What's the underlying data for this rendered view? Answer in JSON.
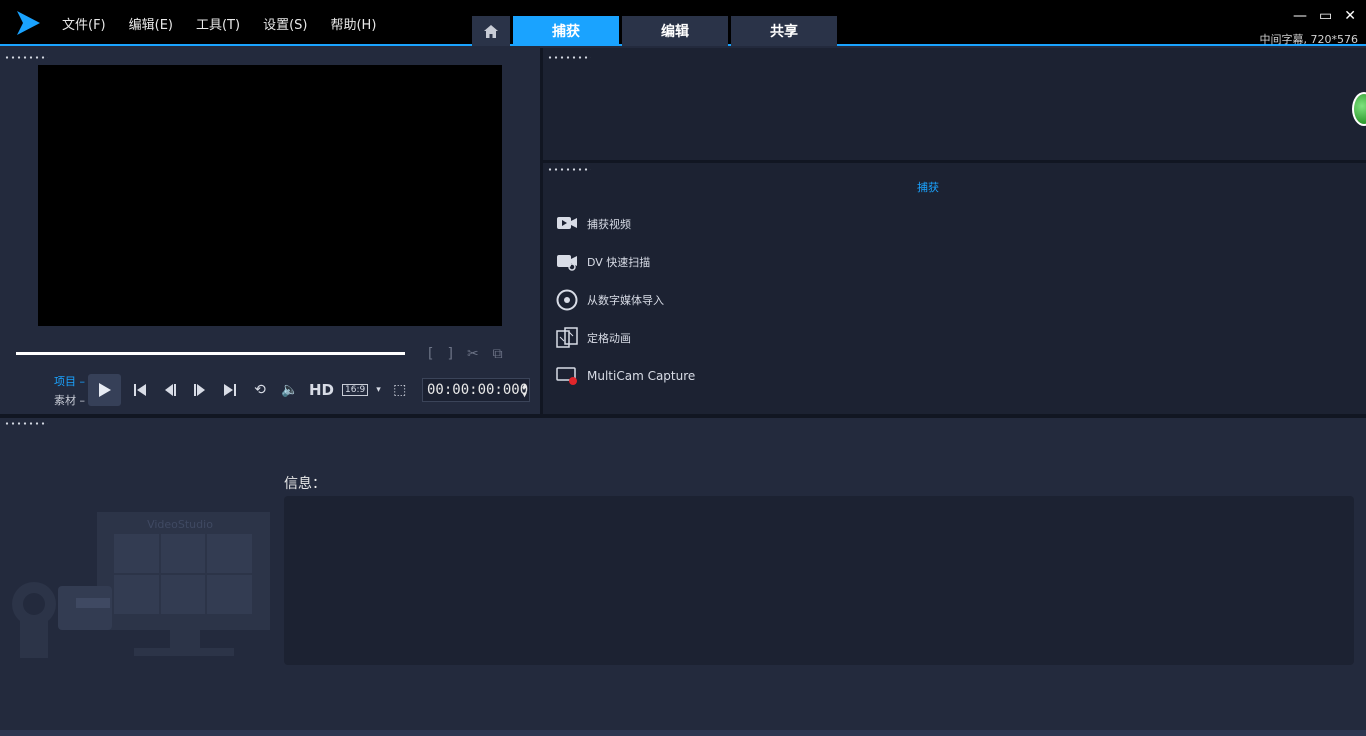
{
  "menu": [
    "文件(F)",
    "编辑(E)",
    "工具(T)",
    "设置(S)",
    "帮助(H)"
  ],
  "tabs": {
    "capture": "捕获",
    "edit": "编辑",
    "share": "共享"
  },
  "window": {
    "minimize": "—",
    "restore": "▭",
    "close": "✕"
  },
  "project_info": "中间字幕, 720*576",
  "player": {
    "mode_project": "项目",
    "mode_clip": "素材",
    "hd_label": "HD",
    "ratio_label": "16:9",
    "timecode": "00:00:00:000"
  },
  "capture": {
    "title": "捕获",
    "items": [
      {
        "label": "捕获视频",
        "icon": "capture-video-icon"
      },
      {
        "label": "DV 快速扫描",
        "icon": "dv-scan-icon"
      },
      {
        "label": "从数字媒体导入",
        "icon": "import-digital-media-icon"
      },
      {
        "label": "定格动画",
        "icon": "stop-motion-icon"
      },
      {
        "label": "MultiCam Capture",
        "icon": "multicam-icon"
      }
    ]
  },
  "info_label": "信息：",
  "watermark_text": "VideoStudio",
  "colors": {
    "accent": "#1aa3ff",
    "panel": "#232a3d",
    "panel_dark": "#1c2232"
  }
}
